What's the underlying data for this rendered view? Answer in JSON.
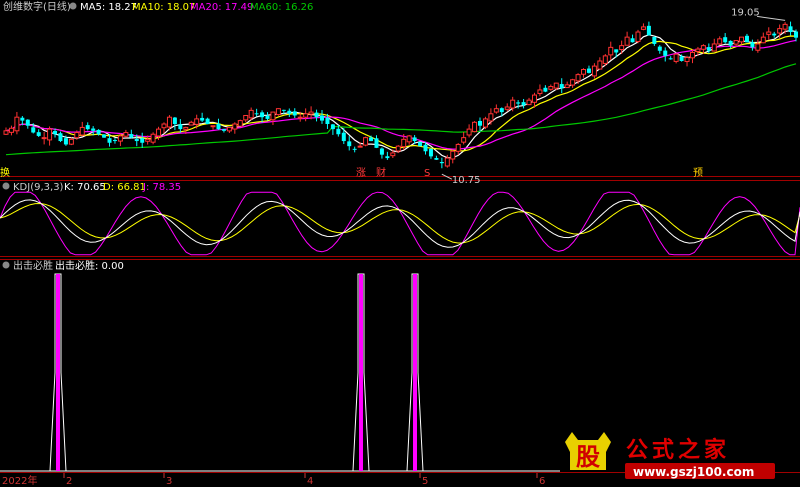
{
  "main_panel": {
    "title": "创维数字(日线)",
    "ma": [
      {
        "label": "MA5: 18.27",
        "color": "#ffffff"
      },
      {
        "label": "MA10: 18.07",
        "color": "#ffff00"
      },
      {
        "label": "MA20: 17.49",
        "color": "#ff00ff"
      },
      {
        "label": "MA60: 16.26",
        "color": "#00c800"
      }
    ],
    "high_label": "19.05",
    "low_label": "10.75",
    "markers": [
      {
        "text": "换",
        "color": "#ffff00",
        "x": 0
      },
      {
        "text": "涨",
        "color": "#ff3b3b",
        "x": 356
      },
      {
        "text": "财",
        "color": "#ff3b3b",
        "x": 376
      },
      {
        "text": "S",
        "color": "#ff3b3b",
        "x": 424
      },
      {
        "text": "预",
        "color": "#ffd000",
        "x": 693
      }
    ]
  },
  "kdj_panel": {
    "name": "KDJ(9,3,3)",
    "k": {
      "label": "K: 70.65",
      "color": "#ffffff"
    },
    "d": {
      "label": "D: 66.81",
      "color": "#ffff00"
    },
    "j": {
      "label": "J: 78.35",
      "color": "#ff00ff"
    }
  },
  "signal_panel": {
    "name": "出击必胜",
    "value_label": "出击必胜: 0.00"
  },
  "x_axis": {
    "year": "2022年",
    "ticks": [
      "2",
      "3",
      "4",
      "5",
      "6"
    ]
  },
  "watermark": {
    "icon_char": "股",
    "text": "公式之家",
    "url": "www.gszj100.com"
  },
  "colors": {
    "up": "#ff3232",
    "down": "#00ffff",
    "separator": "#a00000",
    "magenta": "#ff00ff"
  },
  "chart_data": [
    {
      "type": "candlestick",
      "title": "创维数字(日线)",
      "series": [
        {
          "name": "MA5",
          "last": 18.27
        },
        {
          "name": "MA10",
          "last": 18.07
        },
        {
          "name": "MA20",
          "last": 17.49
        },
        {
          "name": "MA60",
          "last": 16.26
        }
      ],
      "annotations": [
        {
          "text": "19.05",
          "meaning": "period high"
        },
        {
          "text": "10.75",
          "meaning": "period low"
        }
      ],
      "closes": [
        12.8,
        12.95,
        13.6,
        13.4,
        13.1,
        12.7,
        12.5,
        12.4,
        12.9,
        12.6,
        12.2,
        12.0,
        12.3,
        12.7,
        13.0,
        12.9,
        12.8,
        12.6,
        12.4,
        12.1,
        12.2,
        12.5,
        12.7,
        12.4,
        12.2,
        12.1,
        12.3,
        12.6,
        12.9,
        13.2,
        13.6,
        13.2,
        12.9,
        13.0,
        13.3,
        13.5,
        13.4,
        13.2,
        13.1,
        12.9,
        12.8,
        13.0,
        13.2,
        13.4,
        13.7,
        14.0,
        13.8,
        13.6,
        13.5,
        13.9,
        14.1,
        14.0,
        13.8,
        13.7,
        13.6,
        13.8,
        13.9,
        13.6,
        13.4,
        13.2,
        12.9,
        12.6,
        12.2,
        11.9,
        11.7,
        11.9,
        12.4,
        12.2,
        11.8,
        11.4,
        11.2,
        11.5,
        11.9,
        12.3,
        12.5,
        12.2,
        11.9,
        11.6,
        11.3,
        11.1,
        10.9,
        11.2,
        11.6,
        12.0,
        12.4,
        12.9,
        13.3,
        13.1,
        13.5,
        13.8,
        14.1,
        13.9,
        14.2,
        14.6,
        14.4,
        14.3,
        14.6,
        14.9,
        15.2,
        15.1,
        15.4,
        15.6,
        15.3,
        15.5,
        15.8,
        16.1,
        16.4,
        16.2,
        16.6,
        16.9,
        17.2,
        17.7,
        17.4,
        17.8,
        18.3,
        18.0,
        18.6,
        18.9,
        18.4,
        17.9,
        17.5,
        17.2,
        17.0,
        17.3,
        16.9,
        17.1,
        17.4,
        17.6,
        17.8,
        17.5,
        17.9,
        18.2,
        18.0,
        17.8,
        18.1,
        18.3,
        18.0,
        17.7,
        17.9,
        18.3,
        18.6,
        18.4,
        18.8,
        19.05,
        18.6,
        18.27
      ],
      "ylim": [
        10.5,
        19.6
      ]
    },
    {
      "type": "line",
      "title": "KDJ(9,3,3)",
      "series": [
        {
          "name": "K",
          "last": 70.65
        },
        {
          "name": "D",
          "last": 66.81
        },
        {
          "name": "J",
          "last": 78.35
        }
      ],
      "ylim": [
        0,
        100
      ]
    },
    {
      "type": "bar",
      "title": "出击必胜",
      "x_positions": [
        58,
        361,
        415
      ],
      "values": [
        1,
        1,
        1
      ],
      "last": 0.0
    }
  ]
}
